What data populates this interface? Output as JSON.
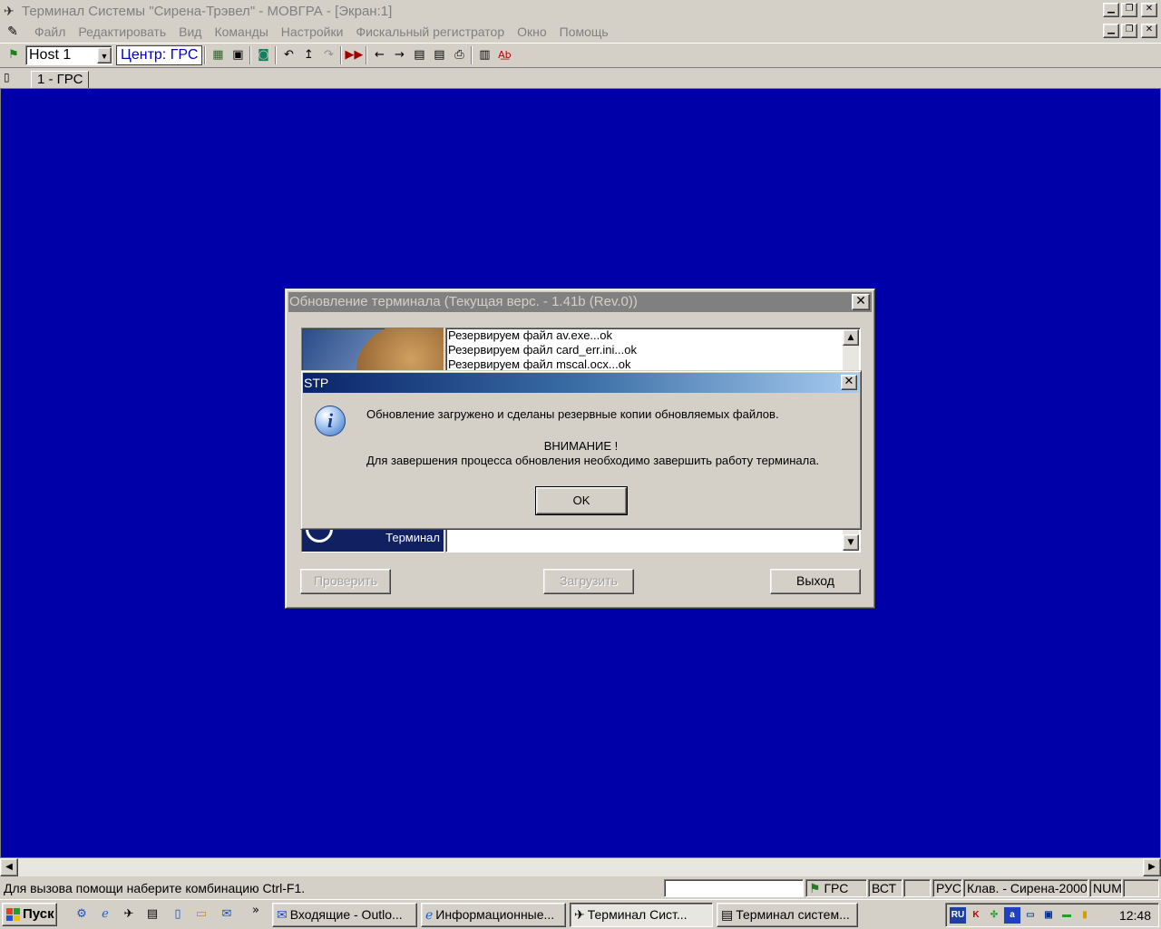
{
  "window": {
    "title": "Терминал Системы \"Сирена-Трэвел\" - МОВГРА - [Экран:1]"
  },
  "menu": {
    "items": [
      "Файл",
      "Редактировать",
      "Вид",
      "Команды",
      "Настройки",
      "Фискальный регистратор",
      "Окно",
      "Помощь"
    ]
  },
  "toolbar": {
    "host_value": "Host 1",
    "center_label": "Центр: ГРС"
  },
  "tabs": {
    "active": "1 - ГРС"
  },
  "update_window": {
    "title": "Обновление терминала (Текущая верс. - 1.41b (Rev.0))",
    "log_lines": [
      "Резервируем файл av.exe...ok",
      "Резервируем файл card_err.ini...ok",
      "Резервируем файл mscal.ocx...ok"
    ],
    "banner_label": "Терминал",
    "check_button": "Проверить",
    "load_button": "Загрузить",
    "exit_button": "Выход"
  },
  "message_box": {
    "title": "STP",
    "line1": "Обновление загружено и сделаны резервные копии обновляемых файлов.",
    "line2": "ВНИМАНИЕ !",
    "line3": "Для завершения процесса обновления необходимо завершить работу терминала.",
    "ok_button": "OK"
  },
  "statusbar": {
    "help_text": "Для вызова помощи наберите комбинацию Ctrl-F1.",
    "grs": "ГРС",
    "vst": "ВСТ",
    "rus": "РУС",
    "keyboard": "Клав. - Сирена-2000",
    "num": "NUM"
  },
  "taskbar": {
    "start": "Пуск",
    "more": "»",
    "tasks": [
      {
        "label": "Входящие - Outlo..."
      },
      {
        "label": "Информационные..."
      },
      {
        "label": "Терминал Сист..."
      },
      {
        "label": "Терминал систем..."
      }
    ],
    "lang": "RU",
    "clock": "12:48"
  }
}
